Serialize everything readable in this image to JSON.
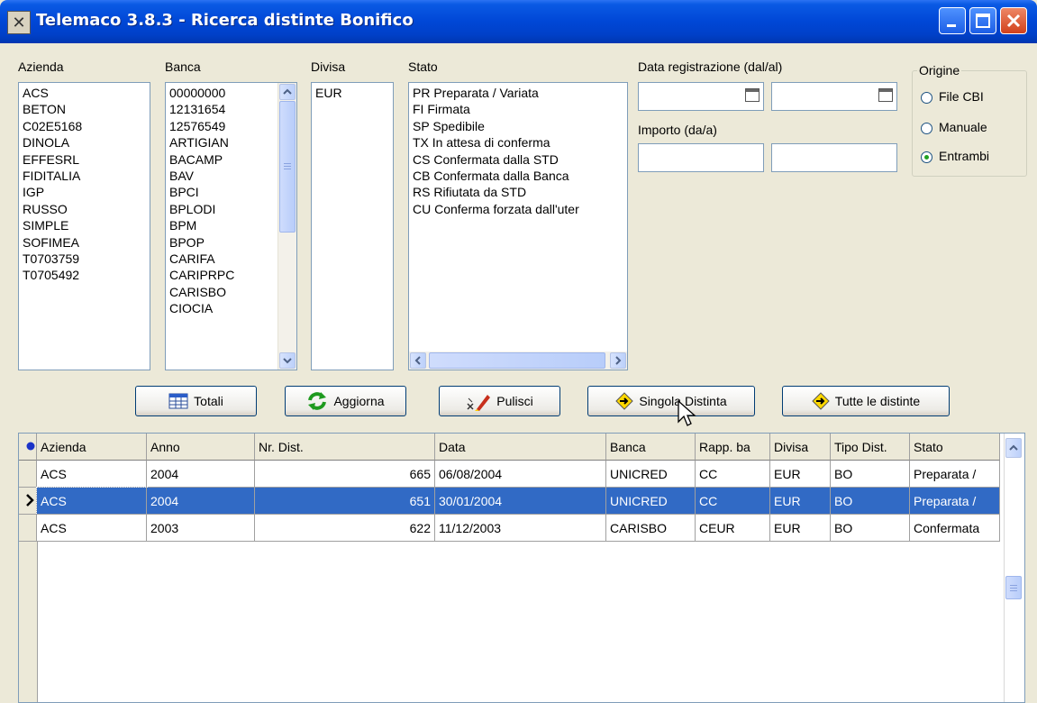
{
  "window": {
    "title": "Telemaco 3.8.3  - Ricerca distinte Bonifico"
  },
  "labels": {
    "azienda": "Azienda",
    "banca": "Banca",
    "divisa": "Divisa",
    "stato": "Stato",
    "data_reg": "Data registrazione (dal/al)",
    "importo": "Importo (da/a)",
    "origine": "Origine"
  },
  "azienda_list": [
    "ACS",
    "BETON",
    "C02E5168",
    "DINOLA",
    "EFFESRL",
    "FIDITALIA",
    "IGP",
    "RUSSO",
    "SIMPLE",
    "SOFIMEA",
    "T0703759",
    "T0705492"
  ],
  "banca_list": [
    "00000000",
    "12131654",
    "12576549",
    "ARTIGIAN",
    "BACAMP",
    "BAV",
    "BPCI",
    "BPLODI",
    "BPM",
    "BPOP",
    "CARIFA",
    "CARIPRPC",
    "CARISBO",
    "CIOCIA"
  ],
  "divisa_list": [
    "EUR"
  ],
  "stato_list": [
    "PR Preparata / Variata",
    "FI  Firmata",
    "SP Spedibile",
    "TX In attesa di conferma",
    "CS Confermata dalla STD",
    "CB Confermata dalla Banca",
    "RS Rifiutata da STD",
    "CU Conferma forzata dall'uter"
  ],
  "origine": {
    "options": [
      "File CBI",
      "Manuale",
      "Entrambi"
    ],
    "selected": "Entrambi"
  },
  "buttons": {
    "totali": "Totali",
    "aggiorna": "Aggiorna",
    "pulisci": "Pulisci",
    "singola": "Singola Distinta",
    "tutte": "Tutte le distinte"
  },
  "grid": {
    "columns": [
      "Azienda",
      "Anno",
      "Nr. Dist.",
      "Data",
      "Banca",
      "Rapp. ba",
      "Divisa",
      "Tipo Dist.",
      "Stato"
    ],
    "rows": [
      [
        "ACS",
        "2004",
        "665",
        "06/08/2004",
        "UNICRED",
        "CC",
        "EUR",
        "BO",
        "Preparata /"
      ],
      [
        "ACS",
        "2004",
        "651",
        "30/01/2004",
        "UNICRED",
        "CC",
        "EUR",
        "BO",
        "Preparata /"
      ],
      [
        "ACS",
        "2003",
        "622",
        "11/12/2003",
        "CARISBO",
        "CEUR",
        "EUR",
        "BO",
        "Confermata"
      ]
    ],
    "selected_row": 1
  },
  "colors": {
    "title_bar": "#0047d6",
    "selection": "#316ac5",
    "face": "#ece9d8"
  }
}
